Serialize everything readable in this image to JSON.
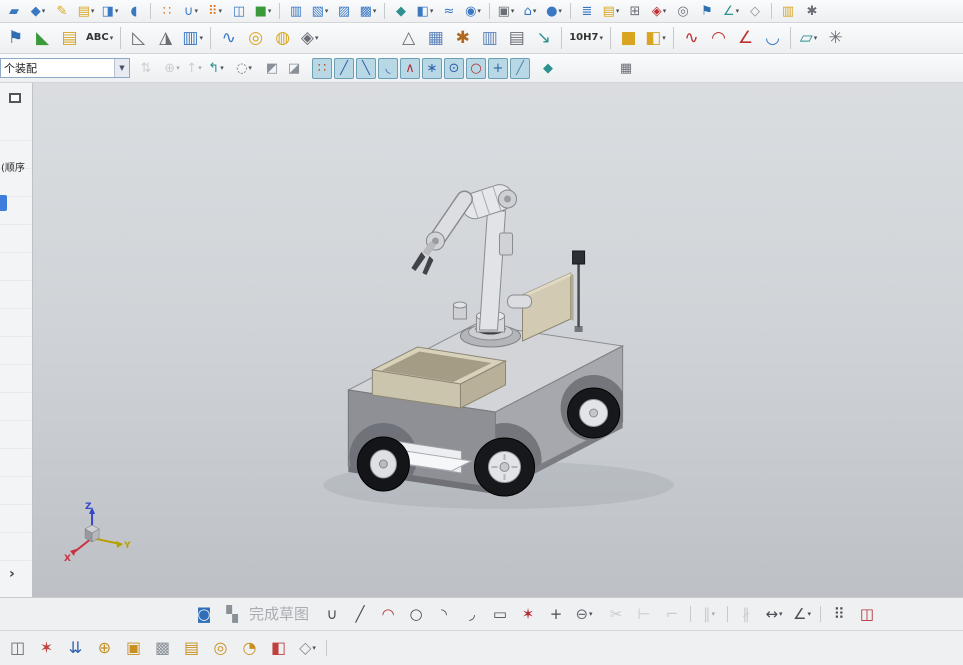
{
  "toolbar_row1": {
    "items": [
      {
        "name": "new-part",
        "glyph": "▰",
        "color": "#3a78c2"
      },
      {
        "name": "sketch-in-task",
        "glyph": "◆",
        "color": "#3a78c2",
        "caret": true
      },
      {
        "name": "pencil-edit",
        "glyph": "✎",
        "color": "#d9a520"
      },
      {
        "name": "layer-doc",
        "glyph": "▤",
        "color": "#d9a520",
        "caret": true
      },
      {
        "name": "extrude",
        "glyph": "◨",
        "color": "#3a78c2",
        "caret": true
      },
      {
        "name": "revolve",
        "glyph": "◖",
        "color": "#3a78c2"
      },
      {
        "sep": true
      },
      {
        "name": "pattern-dots",
        "glyph": "∷",
        "color": "#e07a20"
      },
      {
        "name": "unite",
        "glyph": "∪",
        "color": "#3a78c2",
        "caret": true
      },
      {
        "name": "pattern-feature",
        "glyph": "⠿",
        "color": "#e07a20",
        "caret": true
      },
      {
        "name": "sheet-copy",
        "glyph": "◫",
        "color": "#3a78c2"
      },
      {
        "name": "green-block",
        "glyph": "■",
        "color": "#3a9a3a",
        "caret": true
      },
      {
        "sep": true
      },
      {
        "name": "page-copy",
        "glyph": "▥",
        "color": "#3a78c2"
      },
      {
        "name": "insert-part",
        "glyph": "▧",
        "color": "#3a78c2",
        "caret": true
      },
      {
        "name": "blue-pages",
        "glyph": "▨",
        "color": "#3a78c2"
      },
      {
        "name": "doc-stack",
        "glyph": "▩",
        "color": "#3a78c2",
        "caret": true
      },
      {
        "sep": true
      },
      {
        "name": "teal-gem",
        "glyph": "◆",
        "color": "#2e9090"
      },
      {
        "name": "half-cube",
        "glyph": "◧",
        "color": "#3a78c2",
        "caret": true
      },
      {
        "name": "wave-link",
        "glyph": "≈",
        "color": "#3a78c2"
      },
      {
        "name": "show-hide",
        "glyph": "◉",
        "color": "#3a78c2",
        "caret": true
      },
      {
        "sep": true
      },
      {
        "name": "window-view",
        "glyph": "▣",
        "color": "#6a6e75",
        "caret": true
      },
      {
        "name": "home-view",
        "glyph": "⌂",
        "color": "#3a78c2",
        "caret": true
      },
      {
        "name": "render-sphere",
        "glyph": "●",
        "color": "#3a78c2",
        "caret": true
      },
      {
        "sep": true
      },
      {
        "name": "nav-list",
        "glyph": "≣",
        "color": "#3a78c2"
      },
      {
        "name": "layer-settings",
        "glyph": "▤",
        "color": "#d9a520",
        "caret": true
      },
      {
        "name": "tool-grid",
        "glyph": "⊞",
        "color": "#6a6e75"
      },
      {
        "name": "red-gem",
        "glyph": "◈",
        "color": "#c03030",
        "caret": true
      },
      {
        "name": "target-circle",
        "glyph": "◎",
        "color": "#6a6e75"
      },
      {
        "name": "flag-tool",
        "glyph": "⚑",
        "color": "#2e6fb0"
      },
      {
        "name": "measure-angle",
        "glyph": "∠",
        "color": "#2e9090",
        "caret": true
      },
      {
        "name": "view-cube",
        "glyph": "◇",
        "color": "#8a9098"
      },
      {
        "sep": true
      },
      {
        "name": "help-doc",
        "glyph": "▥",
        "color": "#d9a520"
      },
      {
        "name": "gear-tool",
        "glyph": "✱",
        "color": "#6a6e75"
      }
    ]
  },
  "toolbar_row2": {
    "items": [
      {
        "name": "open-flag",
        "glyph": "⚑",
        "color": "#2e6fb0"
      },
      {
        "name": "green-corner",
        "glyph": "◣",
        "color": "#3a9a3a"
      },
      {
        "name": "note-book",
        "glyph": "▤",
        "color": "#d9a520"
      },
      {
        "name": "text-annotation",
        "label": "ABC",
        "caret": true
      },
      {
        "sep": true
      },
      {
        "name": "draft-angle",
        "glyph": "◺",
        "color": "#6a6e75"
      },
      {
        "name": "emboss",
        "glyph": "◮",
        "color": "#6a6e75"
      },
      {
        "name": "sweep-list",
        "glyph": "▥",
        "color": "#3a78c2",
        "caret": true
      },
      {
        "sep": true
      },
      {
        "name": "spring",
        "glyph": "∿",
        "color": "#3a78c2"
      },
      {
        "name": "coil",
        "glyph": "◎",
        "color": "#d9a520"
      },
      {
        "name": "washer",
        "glyph": "◍",
        "color": "#d9a520"
      },
      {
        "name": "shape-more",
        "glyph": "◈",
        "color": "#6a6e75",
        "caret": true
      },
      {
        "gap": 72
      },
      {
        "name": "triangle-patch",
        "glyph": "△",
        "color": "#6a6e75"
      },
      {
        "name": "mesh-grid",
        "glyph": "▦",
        "color": "#5a82b8"
      },
      {
        "name": "gear-wheel",
        "glyph": "✱",
        "color": "#b06a20"
      },
      {
        "name": "data-table",
        "glyph": "▥",
        "color": "#5a82b8"
      },
      {
        "name": "report-sheet",
        "glyph": "▤",
        "color": "#6a6e75"
      },
      {
        "name": "flow-arrow",
        "glyph": "↘",
        "color": "#2e9090"
      },
      {
        "sep": true
      },
      {
        "name": "fit-tolerance",
        "label": "10H7",
        "caret": true
      },
      {
        "sep": true
      },
      {
        "name": "block-yellow",
        "glyph": "■",
        "color": "#d9a520"
      },
      {
        "name": "block-pair",
        "glyph": "◧",
        "color": "#d9a520",
        "caret": true
      },
      {
        "sep": true
      },
      {
        "name": "studio-spline",
        "glyph": "∿",
        "color": "#c03030"
      },
      {
        "name": "arc-points",
        "glyph": "◠",
        "color": "#c03030"
      },
      {
        "name": "angle-line",
        "glyph": "∠",
        "color": "#c03030"
      },
      {
        "name": "surface-patch",
        "glyph": "◡",
        "color": "#3a78c2"
      },
      {
        "sep": true
      },
      {
        "name": "flatten-sheet",
        "glyph": "▱",
        "color": "#2e9090",
        "caret": true
      },
      {
        "name": "twist-tool",
        "glyph": "✳",
        "color": "#6a6e75"
      }
    ]
  },
  "toolbar_row3": {
    "selection_scope_value": "个装配",
    "dropdown_caret": "▼",
    "items": [
      {
        "name": "filter-arrows",
        "glyph": "⇅",
        "color": "#9aa0a8",
        "disabled": true
      },
      {
        "gap": 4
      },
      {
        "name": "general-select",
        "glyph": "⊕",
        "color": "#9aa0a8",
        "caret": true,
        "disabled": true
      },
      {
        "name": "select-up",
        "glyph": "↑",
        "color": "#9aa0a8",
        "caret": true,
        "disabled": true
      },
      {
        "name": "previous-selection",
        "glyph": "↰",
        "color": "#2e9090",
        "caret": true
      },
      {
        "gap": 6
      },
      {
        "name": "marquee-mode",
        "glyph": "◌",
        "color": "#6a6e75",
        "caret": true
      },
      {
        "gap": 6
      },
      {
        "name": "shaded-select-a",
        "glyph": "◩",
        "color": "#8a9098"
      },
      {
        "name": "shaded-select-b",
        "glyph": "◪",
        "color": "#8a9098"
      },
      {
        "gap": 6
      },
      {
        "name": "snap-point-enable",
        "glyph": "∷",
        "color": "#c05020",
        "pressed": true
      },
      {
        "name": "snap-endpoint",
        "glyph": "╱",
        "color": "#2f5fae",
        "pressed": true
      },
      {
        "name": "snap-midpoint",
        "glyph": "╲",
        "color": "#2f5fae",
        "pressed": true
      },
      {
        "name": "snap-control-point",
        "glyph": "◟",
        "color": "#2f5fae",
        "pressed": true
      },
      {
        "name": "snap-pole",
        "glyph": "∧",
        "color": "#b3303a",
        "pressed": true
      },
      {
        "name": "snap-existing-point",
        "glyph": "∗",
        "color": "#2f5fae",
        "pressed": true
      },
      {
        "name": "snap-center",
        "glyph": "⊙",
        "color": "#2f5fae",
        "pressed": true
      },
      {
        "name": "snap-quadrant",
        "glyph": "○",
        "color": "#b3303a",
        "pressed": true
      },
      {
        "name": "snap-intersection",
        "glyph": "+",
        "color": "#2f5fae",
        "pressed": true
      },
      {
        "name": "snap-on-curve",
        "glyph": "╱",
        "color": "#5a82b8",
        "pressed": true
      },
      {
        "gap": 6
      },
      {
        "name": "snap-preferences",
        "glyph": "◆",
        "color": "#2e9090"
      },
      {
        "gap": 56
      },
      {
        "name": "data-grid",
        "glyph": "▦",
        "color": "#6a6e75"
      }
    ]
  },
  "sidebar": {
    "title_fragment": "(顺序",
    "chevron": "›"
  },
  "viewport": {
    "triad": {
      "x_label": "X",
      "y_label": "Y",
      "z_label": "Z"
    }
  },
  "colors": {
    "pressed_toggle_bg": "#b7d8e4",
    "selection_blue": "#3d7edb",
    "triad": {
      "x": "#cc2f3f",
      "y": "#b7a100",
      "z": "#3546c8"
    }
  },
  "sketch_toolbar": {
    "items": [
      {
        "name": "finish-sketch",
        "glyph": "◙",
        "color": "#2f6fb8"
      },
      {
        "name": "sketch-checker",
        "glyph": "▚",
        "color": "#8a9098"
      },
      {
        "name": "finish-sketch-label",
        "label": "完成草图",
        "color": "#a9adb3",
        "big": true
      },
      {
        "gap": 6
      },
      {
        "name": "profile",
        "glyph": "∪",
        "color": "#4a4e55"
      },
      {
        "name": "line",
        "glyph": "╱",
        "color": "#4a4e55"
      },
      {
        "name": "arc",
        "glyph": "◠",
        "color": "#b3303a"
      },
      {
        "name": "circle",
        "glyph": "○",
        "color": "#4a4e55"
      },
      {
        "name": "fillet",
        "glyph": "◝",
        "color": "#4a4e55"
      },
      {
        "name": "chamfer",
        "glyph": "◞",
        "color": "#4a4e55"
      },
      {
        "name": "rectangle",
        "glyph": "▭",
        "color": "#4a4e55"
      },
      {
        "name": "polygon",
        "glyph": "✶",
        "color": "#b3303a"
      },
      {
        "name": "point",
        "glyph": "+",
        "color": "#4a4e55"
      },
      {
        "name": "ellipse",
        "glyph": "⊖",
        "color": "#6a6e75",
        "caret": true
      },
      {
        "gap": 4
      },
      {
        "name": "quick-trim",
        "glyph": "✂",
        "color": "#9aa0a8",
        "disabled": true
      },
      {
        "name": "quick-extend",
        "glyph": "⊢",
        "color": "#9aa0a8",
        "disabled": true
      },
      {
        "name": "make-corner",
        "glyph": "⌐",
        "color": "#9aa0a8",
        "disabled": true
      },
      {
        "sep": true
      },
      {
        "name": "offset-curve",
        "glyph": "∥",
        "color": "#9aa0a8",
        "disabled": true,
        "caret": true
      },
      {
        "sep": true
      },
      {
        "name": "show-constraints",
        "glyph": "∦",
        "color": "#9aa0a8",
        "disabled": true
      },
      {
        "name": "rapid-dimension",
        "glyph": "↔",
        "color": "#4a4e55",
        "caret": true
      },
      {
        "name": "angle-dimension",
        "glyph": "∠",
        "color": "#4a4e55",
        "caret": true
      },
      {
        "sep": true
      },
      {
        "name": "pattern-curve",
        "glyph": "⠿",
        "color": "#4a4e55"
      },
      {
        "name": "mirror-curve",
        "glyph": "◫",
        "color": "#b3303a"
      }
    ]
  },
  "bottom_toolbar": {
    "items": [
      {
        "name": "datum-snapshot",
        "glyph": "◫",
        "color": "#6a6e75"
      },
      {
        "name": "pinwheel-view",
        "glyph": "✶",
        "color": "#c04040"
      },
      {
        "name": "align-arrows",
        "glyph": "⇊",
        "color": "#2f5fae"
      },
      {
        "name": "move-body",
        "glyph": "⊕",
        "color": "#c89020"
      },
      {
        "name": "copy-body",
        "glyph": "▣",
        "color": "#c89020"
      },
      {
        "name": "cube-cluster",
        "glyph": "▩",
        "color": "#8a9098"
      },
      {
        "name": "sheet-body",
        "glyph": "▤",
        "color": "#c89020"
      },
      {
        "name": "torus-ring",
        "glyph": "◎",
        "color": "#c89020"
      },
      {
        "name": "half-ring",
        "glyph": "◔",
        "color": "#c89020"
      },
      {
        "name": "section-red",
        "glyph": "◧",
        "color": "#c04040"
      },
      {
        "name": "iso-cube",
        "glyph": "◇",
        "color": "#8a9098",
        "caret": true
      },
      {
        "sep": true
      }
    ]
  }
}
